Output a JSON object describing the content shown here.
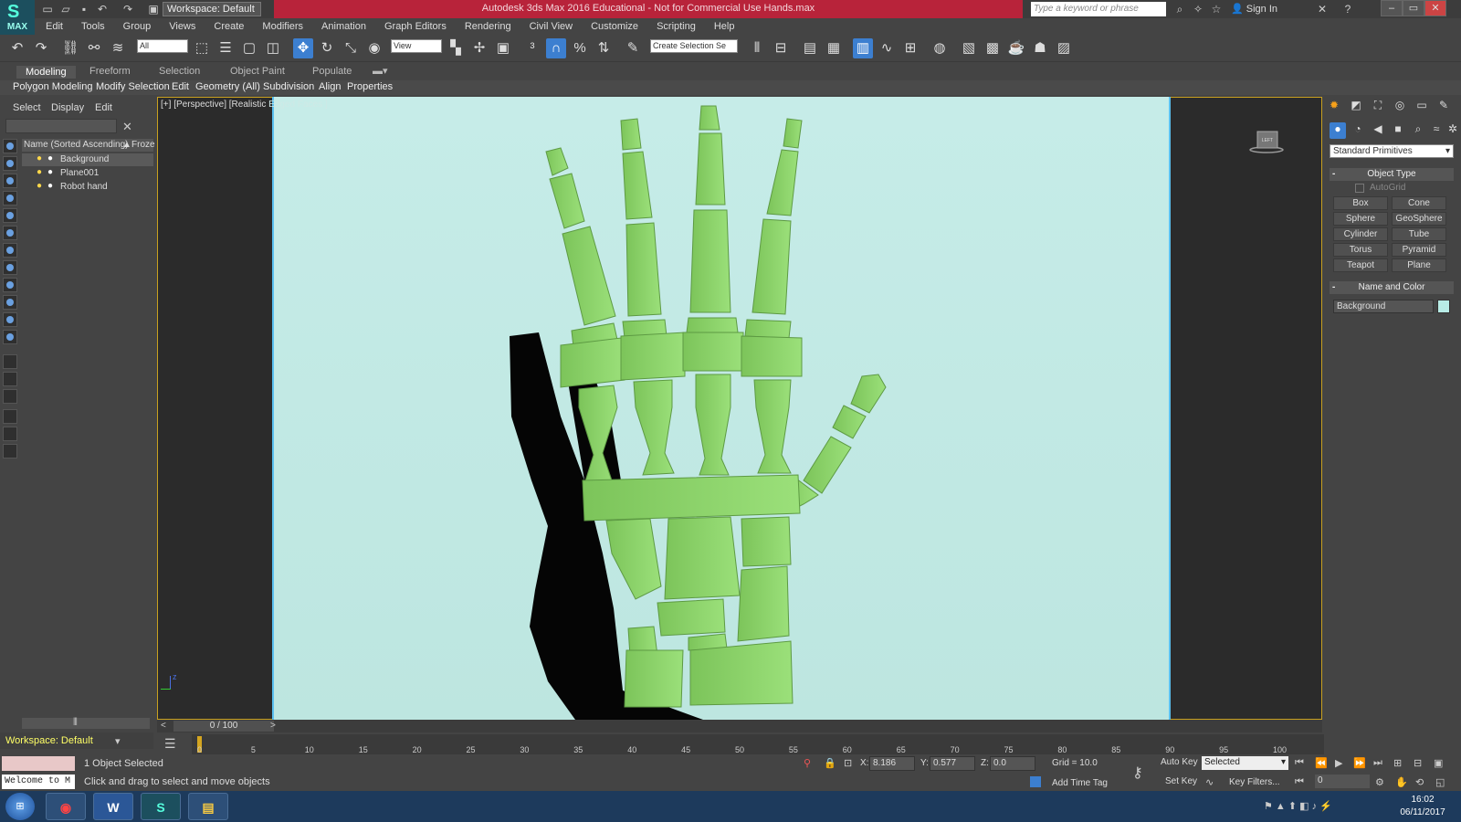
{
  "app": {
    "title": "Autodesk 3ds Max 2016 Educational - Not for Commercial Use    Hands.max",
    "logo_text": "MAX",
    "workspace": "Workspace: Default",
    "search_placeholder": "Type a keyword or phrase",
    "sign_in": "Sign In"
  },
  "menu": [
    "Edit",
    "Tools",
    "Group",
    "Views",
    "Create",
    "Modifiers",
    "Animation",
    "Graph Editors",
    "Rendering",
    "Civil View",
    "Customize",
    "Scripting",
    "Help"
  ],
  "toolbar": {
    "filter": "All",
    "ref_coord": "View",
    "selection_set": "Create Selection Se"
  },
  "ribbon": {
    "tabs": [
      "Modeling",
      "Freeform",
      "Selection",
      "Object Paint",
      "Populate"
    ],
    "subtabs": [
      "Polygon Modeling",
      "Modify Selection",
      "Edit",
      "Geometry (All)",
      "Subdivision",
      "Align",
      "Properties"
    ]
  },
  "explorer": {
    "tabs": [
      "Select",
      "Display",
      "Edit"
    ],
    "col_name": "Name (Sorted Ascending)",
    "col_frozen": "Froze",
    "items": [
      "Background",
      "Plane001",
      "Robot hand"
    ],
    "workspace": "Workspace: Default"
  },
  "viewport": {
    "label_plus": "[+]",
    "label_view": "[Perspective]",
    "label_shading": "[Realistic",
    "label_edges": "Edged Faces ]",
    "viewcube_label": "LEFT",
    "axis_label": "z"
  },
  "command_panel": {
    "primitive_type": "Standard Primitives",
    "object_type": "Object Type",
    "autogrid": "AutoGrid",
    "primitives": [
      "Box",
      "Cone",
      "Sphere",
      "GeoSphere",
      "Cylinder",
      "Tube",
      "Torus",
      "Pyramid",
      "Teapot",
      "Plane"
    ],
    "name_and_color": "Name and Color",
    "name_value": "Background",
    "swatch_color": "#b8ece6"
  },
  "timeline": {
    "counter": "0 / 100",
    "ticks": [
      "0",
      "5",
      "10",
      "15",
      "20",
      "25",
      "30",
      "35",
      "40",
      "45",
      "50",
      "55",
      "60",
      "65",
      "70",
      "75",
      "80",
      "85",
      "90",
      "95",
      "100"
    ]
  },
  "status": {
    "listener": "Welcome to M",
    "selection": "1 Object Selected",
    "prompt": "Click and drag to select and move objects",
    "x_label": "X:",
    "x": "8.186",
    "y_label": "Y:",
    "y": "0.577",
    "z_label": "Z:",
    "z": "0.0",
    "grid": "Grid = 10.0",
    "add_time_tag": "Add Time Tag",
    "auto_key": "Auto Key",
    "set_key": "Set Key",
    "selected": "Selected",
    "key_filters": "Key Filters...",
    "frame": "0"
  },
  "taskbar": {
    "time": "16:02",
    "date": "06/11/2017"
  },
  "colors": {
    "title_red": "#b8233a",
    "viewport_bg": "#c6ece8",
    "hand_green": "#8ed56a",
    "accent_blue": "#3c7fd0"
  }
}
